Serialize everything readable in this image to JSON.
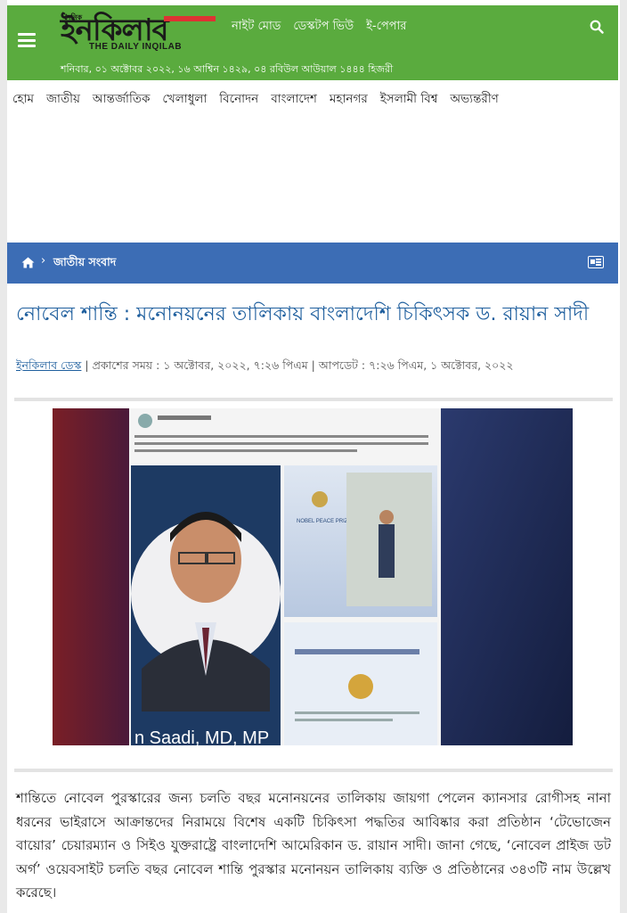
{
  "header": {
    "logo_small": "দৈনিক",
    "logo_main": "ইনকিলাব",
    "logo_sub": "THE DAILY INQILAB",
    "links": [
      "নাইট মোড",
      "ডেস্কটপ ভিউ",
      "ই-পেপার"
    ],
    "dateline": "শনিবার, ০১ অক্টোবর ২০২২, ১৬ আশ্বিন ১৪২৯, ০৪ রবিউল আউয়াল ১৪৪৪ হিজরী"
  },
  "nav": {
    "items": [
      "হোম",
      "জাতীয়",
      "আন্তর্জাতিক",
      "খেলাধুলা",
      "বিনোদন",
      "বাংলাদেশ",
      "মহানগর",
      "ইসলামী বিশ্ব",
      "অভ্যন্তরীণ"
    ]
  },
  "breadcrumb": {
    "separator": "›",
    "label": "জাতীয় সংবাদ"
  },
  "article": {
    "headline": "নোবেল শান্তি : মনোনয়নের তালিকায় বাংলাদেশি চিকিৎসক ড. রায়ান সাদী",
    "author": "ইনকিলাব ডেস্ক",
    "meta": " | প্রকাশের সময় : ১ অক্টোবর, ২০২২, ৭:২৬ পিএম | আপডেট : ৭:২৬ পিএম, ১ অক্টোবর, ২০২২",
    "image_caption_text": "n Saadi, MD, MP",
    "image_banner_text": "NOBEL PEACE PRIZE NOMINEE",
    "body": "শান্তিতে নোবেল পুরস্কারের জন্য চলতি বছর মনোনয়নের তালিকায় জায়গা পেলেন ক্যানসার রোগীসহ নানা ধরনের ভাইরাসে আক্রান্তদের নিরাময়ে বিশেষ একটি চিকিৎসা পদ্ধতির আবিষ্কার করা প্রতিষ্ঠান ‘টেভোজেন বায়োর’ চেয়ারম্যান ও সিইও যুক্তরাষ্ট্রে বাংলাদেশি আমেরিকান ড. রায়ান সাদী। জানা গেছে, ‘নোবেল প্রাইজ ডট অর্গ’ ওয়েবসাইট চলতি বছর নোবেল শান্তি পুরস্কার মনোনয়ন তালিকায় ব্যক্তি ও প্রতিষ্ঠানের ৩৪৩টি নাম উল্লেখ করেছে।"
  },
  "colors": {
    "header_green": "#5aab3e",
    "breadcrumb_blue": "#3c6db5",
    "headline_blue": "#1f5f9e"
  },
  "icons": [
    "menu-icon",
    "search-icon",
    "home-icon",
    "news-list-icon"
  ]
}
